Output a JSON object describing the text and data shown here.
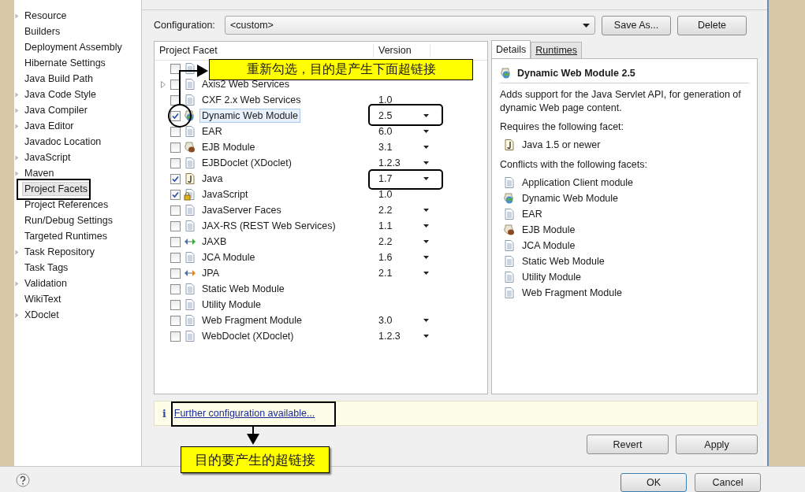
{
  "sidebar": {
    "items": [
      {
        "label": "Resource",
        "expandable": true,
        "selected": false
      },
      {
        "label": "Builders",
        "expandable": false,
        "selected": false
      },
      {
        "label": "Deployment Assembly",
        "expandable": false,
        "selected": false
      },
      {
        "label": "Hibernate Settings",
        "expandable": false,
        "selected": false
      },
      {
        "label": "Java Build Path",
        "expandable": false,
        "selected": false
      },
      {
        "label": "Java Code Style",
        "expandable": true,
        "selected": false
      },
      {
        "label": "Java Compiler",
        "expandable": true,
        "selected": false
      },
      {
        "label": "Java Editor",
        "expandable": true,
        "selected": false
      },
      {
        "label": "Javadoc Location",
        "expandable": false,
        "selected": false
      },
      {
        "label": "JavaScript",
        "expandable": true,
        "selected": false
      },
      {
        "label": "Maven",
        "expandable": true,
        "selected": false
      },
      {
        "label": "Project Facets",
        "expandable": false,
        "selected": true
      },
      {
        "label": "Project References",
        "expandable": false,
        "selected": false
      },
      {
        "label": "Run/Debug Settings",
        "expandable": false,
        "selected": false
      },
      {
        "label": "Targeted Runtimes",
        "expandable": false,
        "selected": false
      },
      {
        "label": "Task Repository",
        "expandable": true,
        "selected": false
      },
      {
        "label": "Task Tags",
        "expandable": false,
        "selected": false
      },
      {
        "label": "Validation",
        "expandable": true,
        "selected": false
      },
      {
        "label": "WikiText",
        "expandable": false,
        "selected": false
      },
      {
        "label": "XDoclet",
        "expandable": true,
        "selected": false
      }
    ]
  },
  "configuration": {
    "label": "Configuration:",
    "value": "<custom>",
    "buttons": [
      "Save As...",
      "Delete"
    ]
  },
  "facets": {
    "columns": [
      "Project Facet",
      "Version"
    ],
    "rows": [
      {
        "kind": "page",
        "checked": false,
        "selected": false,
        "expandable": false
      },
      {
        "name": "Axis2 Web Services",
        "kind": "page",
        "checked": false,
        "selected": false,
        "expandable": true
      },
      {
        "name": "CXF 2.x Web Services",
        "version": "1.0",
        "dropdown": false,
        "kind": "page",
        "checked": false,
        "selected": false,
        "expandable": false
      },
      {
        "name": "Dynamic Web Module",
        "version": "2.5",
        "dropdown": true,
        "kind": "web",
        "checked": true,
        "selected": true,
        "expandable": false
      },
      {
        "name": "EAR",
        "version": "6.0",
        "dropdown": true,
        "kind": "page",
        "checked": false,
        "selected": false,
        "expandable": false
      },
      {
        "name": "EJB Module",
        "version": "3.1",
        "dropdown": true,
        "kind": "jar",
        "checked": false,
        "selected": false,
        "expandable": false
      },
      {
        "name": "EJBDoclet (XDoclet)",
        "version": "1.2.3",
        "dropdown": true,
        "kind": "page",
        "checked": false,
        "selected": false,
        "expandable": false
      },
      {
        "name": "Java",
        "version": "1.7",
        "dropdown": true,
        "kind": "java",
        "checked": true,
        "selected": false,
        "expandable": false
      },
      {
        "name": "JavaScript",
        "version": "1.0",
        "dropdown": false,
        "kind": "lock",
        "checked": true,
        "selected": false,
        "expandable": false
      },
      {
        "name": "JavaServer Faces",
        "version": "2.2",
        "dropdown": true,
        "kind": "page",
        "checked": false,
        "selected": false,
        "expandable": false
      },
      {
        "name": "JAX-RS (REST Web Services)",
        "version": "1.1",
        "dropdown": true,
        "kind": "page",
        "checked": false,
        "selected": false,
        "expandable": false
      },
      {
        "name": "JAXB",
        "version": "2.2",
        "dropdown": true,
        "kind": "greenarrows",
        "checked": false,
        "selected": false,
        "expandable": false
      },
      {
        "name": "JCA Module",
        "version": "1.6",
        "dropdown": true,
        "kind": "page",
        "checked": false,
        "selected": false,
        "expandable": false
      },
      {
        "name": "JPA",
        "version": "2.1",
        "dropdown": true,
        "kind": "orangearrows",
        "checked": false,
        "selected": false,
        "expandable": false
      },
      {
        "name": "Static Web Module",
        "kind": "page",
        "checked": false,
        "selected": false,
        "expandable": false
      },
      {
        "name": "Utility Module",
        "kind": "page",
        "checked": false,
        "selected": false,
        "expandable": false
      },
      {
        "name": "Web Fragment Module",
        "version": "3.0",
        "dropdown": true,
        "kind": "page",
        "checked": false,
        "selected": false,
        "expandable": false
      },
      {
        "name": "WebDoclet (XDoclet)",
        "version": "1.2.3",
        "dropdown": true,
        "kind": "page",
        "checked": false,
        "selected": false,
        "expandable": false
      }
    ]
  },
  "details": {
    "tabs": [
      {
        "label": "Details",
        "selected": true
      },
      {
        "label": "Runtimes",
        "selected": false
      }
    ],
    "title": "Dynamic Web Module 2.5",
    "description": "Adds support for the Java Servlet API, for generation of dynamic Web page content.",
    "requires_label": "Requires the following facet:",
    "requires": [
      {
        "label": "Java 1.5 or newer",
        "kind": "java"
      }
    ],
    "conflicts_label": "Conflicts with the following facets:",
    "conflicts": [
      {
        "label": "Application Client module",
        "kind": "page"
      },
      {
        "label": "Dynamic Web Module",
        "kind": "web"
      },
      {
        "label": "EAR",
        "kind": "page"
      },
      {
        "label": "EJB Module",
        "kind": "jar"
      },
      {
        "label": "JCA Module",
        "kind": "page"
      },
      {
        "label": "Static Web Module",
        "kind": "page"
      },
      {
        "label": "Utility Module",
        "kind": "page"
      },
      {
        "label": "Web Fragment Module",
        "kind": "page"
      }
    ]
  },
  "info_bar": {
    "icon": "i",
    "link": "Further configuration available..."
  },
  "actions": [
    "Revert",
    "Apply"
  ],
  "dialog_buttons": [
    "OK",
    "Cancel"
  ],
  "annotations": [
    {
      "kind": "callout",
      "text": "重新勾选，目的是产生下面超链接"
    },
    {
      "kind": "callout",
      "text": "目的要产生的超链接"
    }
  ]
}
